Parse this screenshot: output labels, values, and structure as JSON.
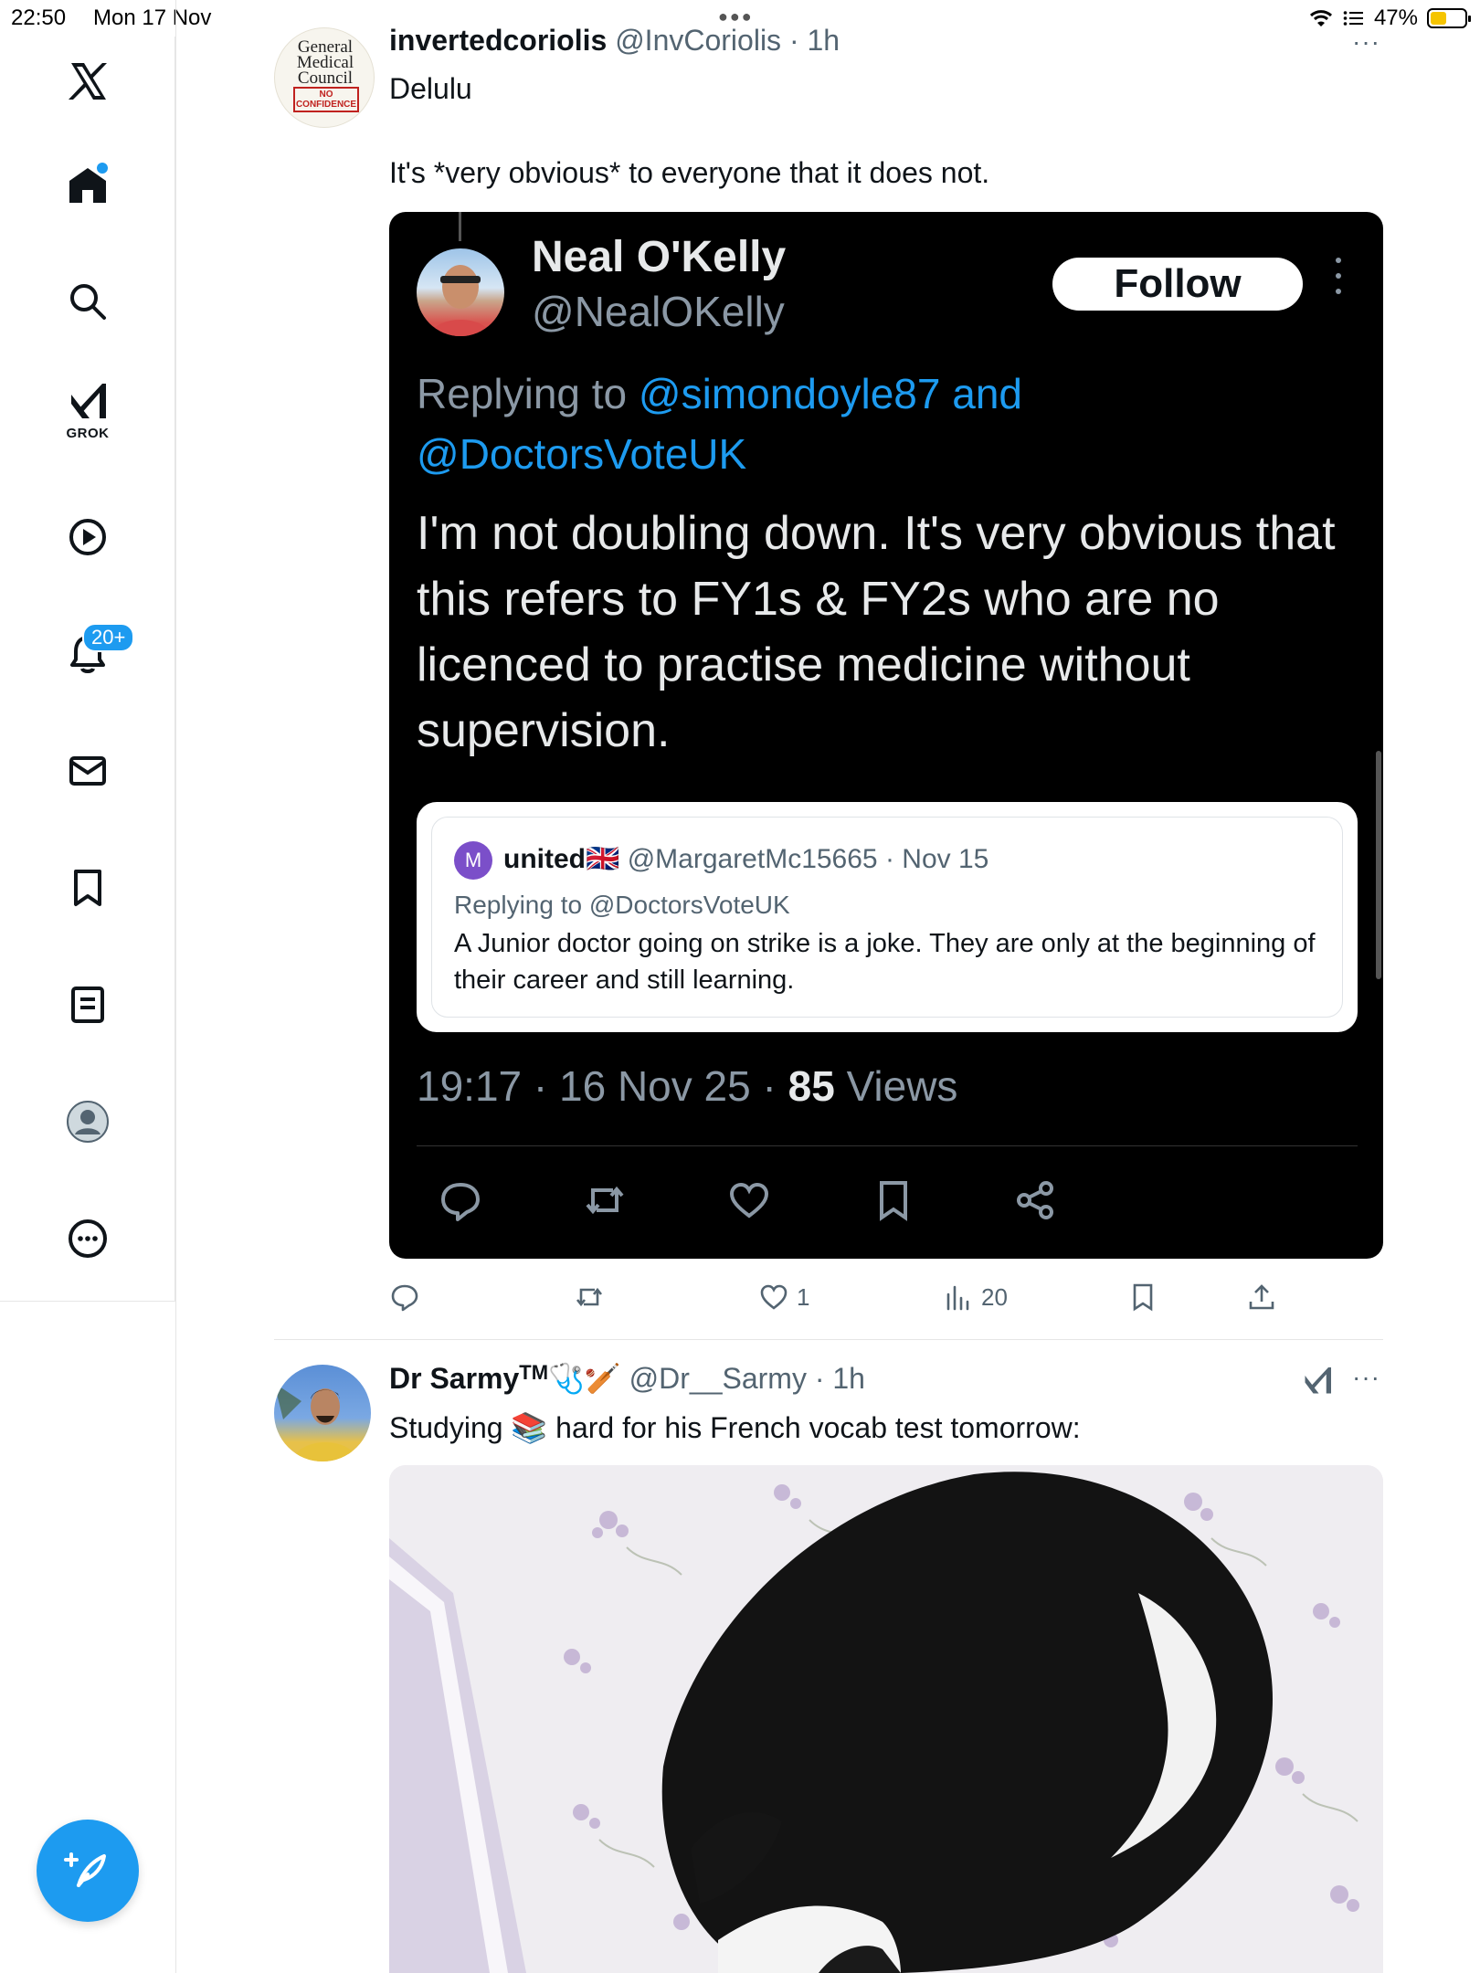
{
  "status_bar": {
    "time": "22:50",
    "date": "Mon 17 Nov",
    "battery": "47%",
    "battery_level": 0.47
  },
  "sidebar": {
    "items": [
      {
        "icon": "x-logo-icon"
      },
      {
        "icon": "home-icon"
      },
      {
        "icon": "search-icon"
      },
      {
        "icon": "grok-icon",
        "label": "GROK"
      },
      {
        "icon": "video-icon"
      },
      {
        "icon": "bell-icon",
        "badge": "20+"
      },
      {
        "icon": "mail-icon"
      },
      {
        "icon": "bookmark-icon"
      },
      {
        "icon": "lists-icon"
      },
      {
        "icon": "profile-icon"
      },
      {
        "icon": "more-icon"
      }
    ],
    "compose_icon": "compose-icon"
  },
  "tweet1": {
    "avatar_text": {
      "line1": "General",
      "line2": "Medical",
      "line3": "Council",
      "stamp1": "NO",
      "stamp2": "CONFIDENCE"
    },
    "name": "invertedcoriolis",
    "handle": "@InvCoriolis",
    "time": "1h",
    "text_line1": "Delulu",
    "text_line2": "It's *very obvious* to everyone that it does not.",
    "embed": {
      "name": "Neal O'Kelly",
      "handle": "@NealOKelly",
      "follow": "Follow",
      "replying_prefix": "Replying to",
      "mention1": "@simondoyle87",
      "and": "and",
      "mention2": "@DoctorsVoteUK",
      "body": "I'm not doubling down.  It's very obvious that this refers to FY1s & FY2s who are no licenced to practise medicine without supervision.",
      "quote": {
        "avatar_letter": "M",
        "name": "united",
        "flag": "🇬🇧",
        "handle": "@MargaretMc15665",
        "date": "Nov 15",
        "replying": "Replying to @DoctorsVoteUK",
        "text": "A Junior doctor going on strike is a joke. They are only at the beginning of their career and still learning."
      },
      "time": "19:17",
      "date": "16 Nov 25",
      "views_count": "85",
      "views_label": "Views"
    },
    "actions": {
      "likes": "1",
      "views": "20"
    }
  },
  "tweet2": {
    "name": "Dr Sarmy",
    "tm": "TM",
    "emoji": "🩺🏏",
    "handle": "@Dr__Sarmy",
    "time": "1h",
    "text_before": "Studying",
    "text_emoji": "📚",
    "text_after": "hard for his French vocab test tomorrow:"
  },
  "colors": {
    "accent": "#1d9bf0",
    "text": "#0f1419",
    "muted": "#536471"
  }
}
